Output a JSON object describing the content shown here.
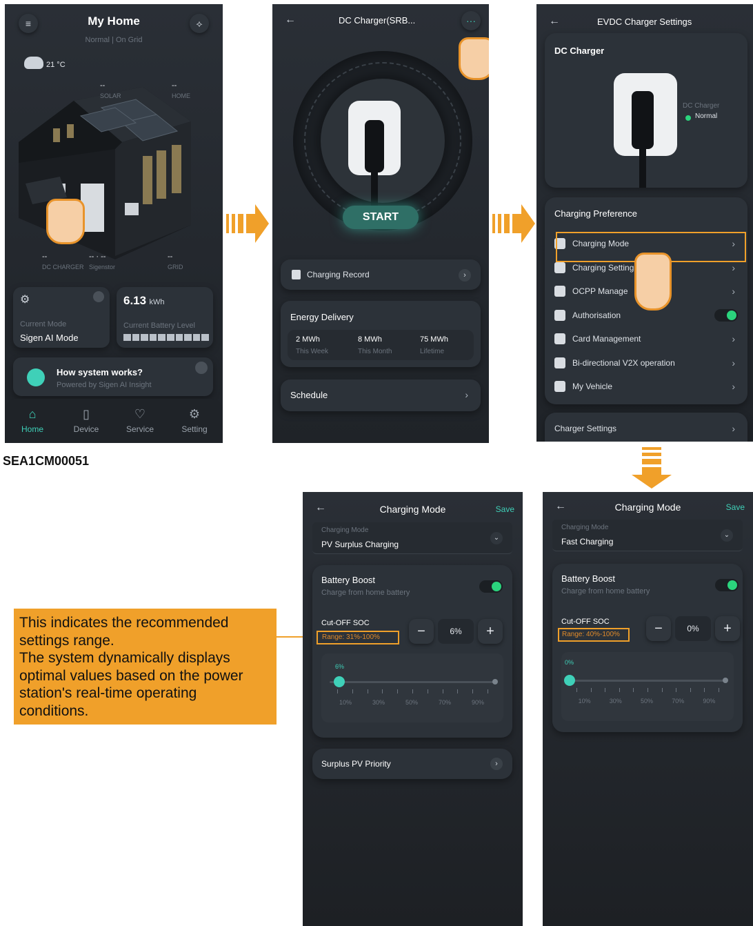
{
  "caption_code": "SEA1CM00051",
  "annotation": {
    "lines": [
      "This indicates the recommended",
      "settings range.",
      "The system dynamically displays",
      "optimal values based on the power",
      "station's real-time operating",
      "conditions."
    ],
    "color": "#f0a02a"
  },
  "home": {
    "title": "My Home",
    "subtitle": "Normal | On Grid",
    "temperature": "21 °C",
    "labels": {
      "solar_dash": "--",
      "solar": "SOLAR",
      "home_dash": "--",
      "home": "HOME",
      "charger_dash": "--",
      "charger": "DC CHARGER",
      "sigenstor_dash": "-- · --",
      "sigenstor": "Sigenstor",
      "grid_dash": "--",
      "grid": "GRID"
    },
    "mode_card": {
      "caption": "Current Mode",
      "value": "Sigen AI Mode"
    },
    "battery_card": {
      "value": "6.13",
      "unit": "kWh",
      "caption": "Current Battery Level",
      "fraction": 1.0
    },
    "how_card": {
      "title": "How system works?",
      "subtitle": "Powered by Sigen AI Insight"
    },
    "nav": [
      {
        "label": "Home",
        "icon": "home-icon",
        "active": true
      },
      {
        "label": "Device",
        "icon": "device-icon",
        "active": false
      },
      {
        "label": "Service",
        "icon": "service-icon",
        "active": false
      },
      {
        "label": "Setting",
        "icon": "setting-icon",
        "active": false
      }
    ]
  },
  "charger": {
    "title": "DC Charger(SRB...",
    "start_label": "START",
    "record_label": "Charging Record",
    "energy_title": "Energy Delivery",
    "energy": [
      {
        "value": "2 MWh",
        "caption": "This Week"
      },
      {
        "value": "8 MWh",
        "caption": "This Month"
      },
      {
        "value": "75 MWh",
        "caption": "Lifetime"
      }
    ],
    "schedule_label": "Schedule"
  },
  "settings": {
    "title": "EVDC Charger Settings",
    "device_title": "DC Charger",
    "device_tag": "DC Charger",
    "device_status": "Normal",
    "pref_title": "Charging Preference",
    "items": [
      {
        "label": "Charging Mode",
        "icon": "charging-mode-icon",
        "control": "chevron"
      },
      {
        "label": "Charging Setting",
        "icon": "charging-setting-icon",
        "control": "chevron"
      },
      {
        "label": "OCPP Manage",
        "icon": "ocpp-icon",
        "control": "chevron"
      },
      {
        "label": "Authorisation",
        "icon": "lock-icon",
        "control": "toggle"
      },
      {
        "label": "Card Management",
        "icon": "card-icon",
        "control": "chevron"
      },
      {
        "label": "Bi-directional V2X operation",
        "icon": "v2x-icon",
        "control": "chevron"
      },
      {
        "label": "My Vehicle",
        "icon": "car-icon",
        "control": "chevron"
      }
    ],
    "charger_settings_label": "Charger Settings"
  },
  "mode_pv": {
    "title": "Charging Mode",
    "save": "Save",
    "select_caption": "Charging Mode",
    "select_value": "PV Surplus Charging",
    "boost_title": "Battery Boost",
    "boost_sub": "Charge from home battery",
    "soc_label": "Cut-OFF SOC",
    "range": "Range: 31%-100%",
    "value": "6%",
    "slider_label": "6%",
    "slider_fraction": 0.06,
    "ticks": [
      "10%",
      "30%",
      "50%",
      "70%",
      "90%"
    ],
    "surplus_label": "Surplus PV Priority"
  },
  "mode_fast": {
    "title": "Charging Mode",
    "save": "Save",
    "select_caption": "Charging Mode",
    "select_value": "Fast Charging",
    "boost_title": "Battery Boost",
    "boost_sub": "Charge from home battery",
    "soc_label": "Cut-OFF SOC",
    "range": "Range: 40%-100%",
    "value": "0%",
    "slider_label": "0%",
    "slider_fraction": 0.0,
    "ticks": [
      "10%",
      "30%",
      "50%",
      "70%",
      "90%"
    ]
  },
  "colors": {
    "accent": "#f0a02a",
    "green": "#2bd47d",
    "teal": "#3fd0b8",
    "screen_bg": "#22272d"
  }
}
